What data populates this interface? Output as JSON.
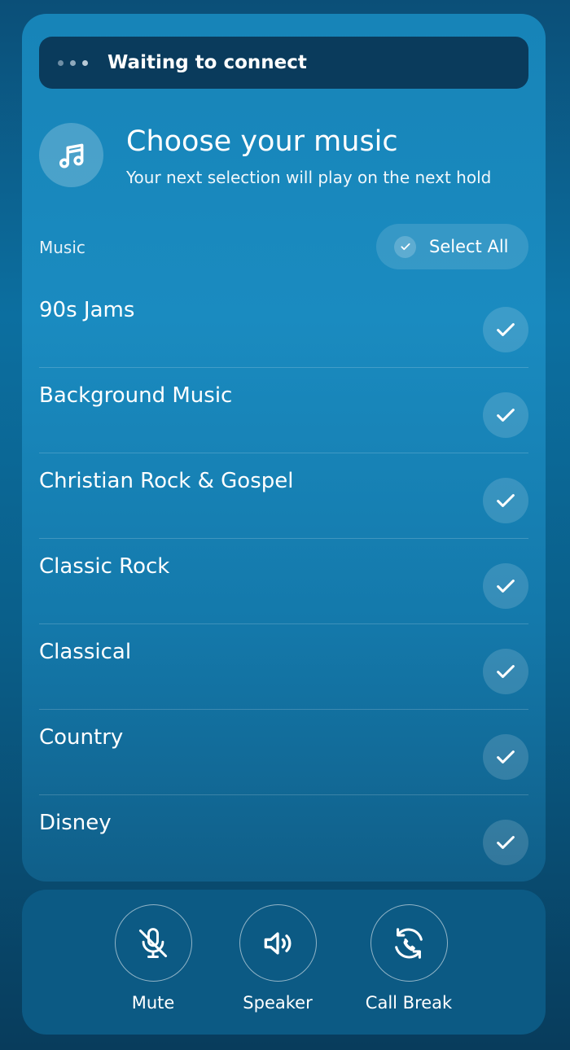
{
  "status": {
    "text": "Waiting to connect"
  },
  "header": {
    "icon": "music-note-icon",
    "title": "Choose your music",
    "subtitle": "Your next selection will play on the next hold"
  },
  "section": {
    "label": "Music",
    "select_all_label": "Select All",
    "select_all_checked": true
  },
  "music_items": [
    {
      "label": "90s Jams",
      "checked": true
    },
    {
      "label": "Background Music",
      "checked": true
    },
    {
      "label": "Christian Rock & Gospel",
      "checked": true
    },
    {
      "label": "Classic Rock",
      "checked": true
    },
    {
      "label": "Classical",
      "checked": true
    },
    {
      "label": "Country",
      "checked": true
    },
    {
      "label": "Disney",
      "checked": true
    }
  ],
  "controls": [
    {
      "label": "Mute",
      "icon": "mic-off-icon"
    },
    {
      "label": "Speaker",
      "icon": "speaker-icon"
    },
    {
      "label": "Call Break",
      "icon": "call-break-icon"
    }
  ],
  "colors": {
    "background_top": "#0b4f78",
    "card": "#1784b8",
    "status_bar": "#0a3b5c",
    "controls_panel": "#0c5a84",
    "text": "#ffffff"
  }
}
